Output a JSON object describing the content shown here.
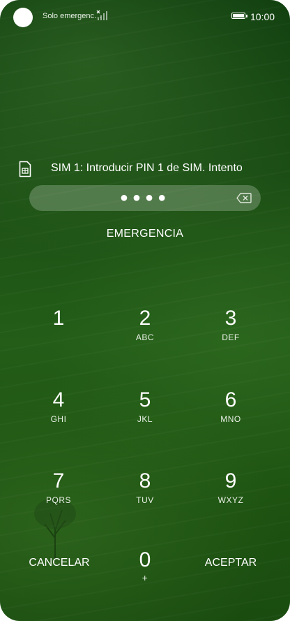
{
  "status_bar": {
    "carrier": "Solo emergenc…",
    "time": "10:00",
    "signal_icon": "no-signal-icon",
    "battery_icon": "battery-full-icon"
  },
  "sim": {
    "icon": "sim-card-icon",
    "message": "SIM 1: Introducir PIN 1 de SIM. Intento"
  },
  "pin": {
    "dots": "●●●●",
    "backspace_icon": "backspace-icon"
  },
  "emergency_label": "EMERGENCIA",
  "keypad": {
    "keys": [
      {
        "digit": "1",
        "letters": ""
      },
      {
        "digit": "2",
        "letters": "ABC"
      },
      {
        "digit": "3",
        "letters": "DEF"
      },
      {
        "digit": "4",
        "letters": "GHI"
      },
      {
        "digit": "5",
        "letters": "JKL"
      },
      {
        "digit": "6",
        "letters": "MNO"
      },
      {
        "digit": "7",
        "letters": "PQRS"
      },
      {
        "digit": "8",
        "letters": "TUV"
      },
      {
        "digit": "9",
        "letters": "WXYZ"
      },
      {
        "digit": "0",
        "letters": "+"
      }
    ],
    "cancel_label": "CANCELAR",
    "accept_label": "ACEPTAR"
  }
}
